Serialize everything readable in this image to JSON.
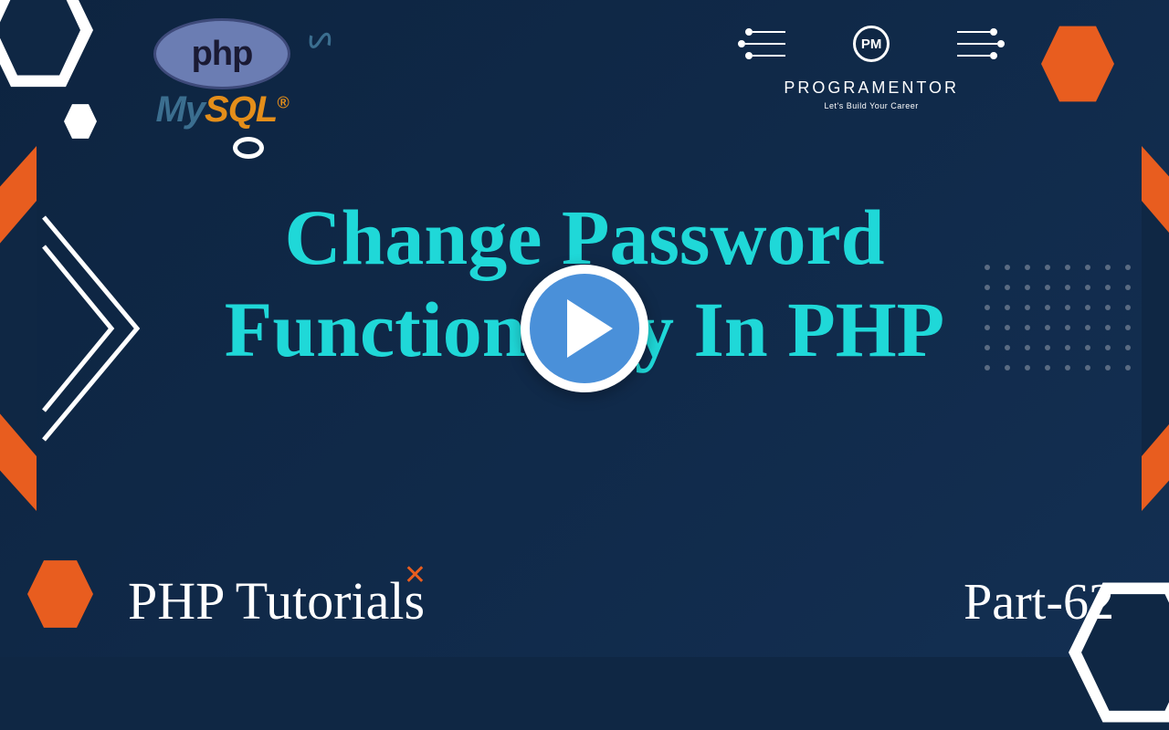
{
  "logos": {
    "php_text": "php",
    "mysql_my": "My",
    "mysql_sql": "SQL"
  },
  "brand": {
    "initials": "PM",
    "name": "PROGRAMENTOR",
    "tagline": "Let's Build Your Career"
  },
  "title": {
    "line1": "Change Password",
    "line2": "Functionality In PHP"
  },
  "footer": {
    "series": "PHP Tutorials",
    "part": "Part-62"
  },
  "colors": {
    "accent_cyan": "#1fd8d8",
    "accent_orange": "#e85d1f",
    "background": "#0f2744"
  }
}
